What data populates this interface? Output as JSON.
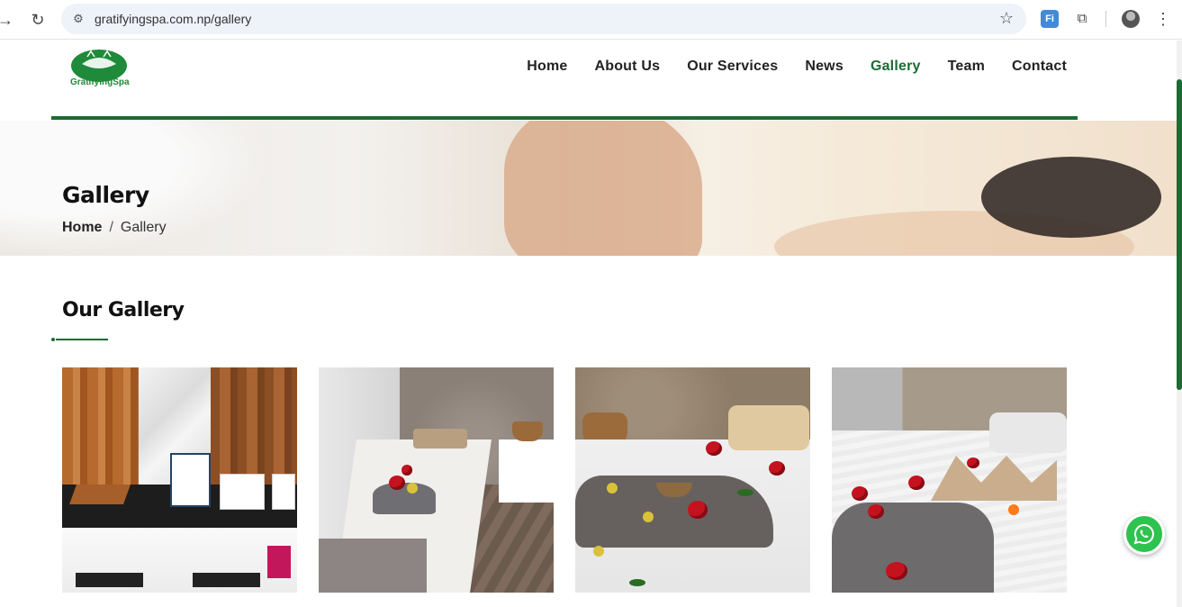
{
  "browser": {
    "url": "gratifyingspa.com.np/gallery",
    "back_icon": "arrow-right-icon",
    "reload_icon": "reload-icon",
    "bookmark_icon": "star-icon",
    "translate_label": "",
    "menu_icon": "kebab-icon"
  },
  "header": {
    "logo_text": "GratifyingSpa",
    "nav": [
      {
        "label": "Home"
      },
      {
        "label": "About Us"
      },
      {
        "label": "Our Services"
      },
      {
        "label": "News"
      },
      {
        "label": "Gallery",
        "active": true
      },
      {
        "label": "Team"
      },
      {
        "label": "Contact"
      }
    ],
    "accent_color": "#1d6b32"
  },
  "hero": {
    "title": "Gallery",
    "breadcrumb": {
      "home": "Home",
      "separator": "/",
      "current": "Gallery"
    }
  },
  "gallery": {
    "title": "Our Gallery",
    "items": [
      {
        "name": "reception-desk-photo"
      },
      {
        "name": "massage-bed-photo-1"
      },
      {
        "name": "massage-bed-photo-2"
      },
      {
        "name": "massage-bed-photo-3"
      }
    ]
  },
  "whatsapp": {
    "icon": "whatsapp-icon",
    "color": "#2ec24f"
  }
}
